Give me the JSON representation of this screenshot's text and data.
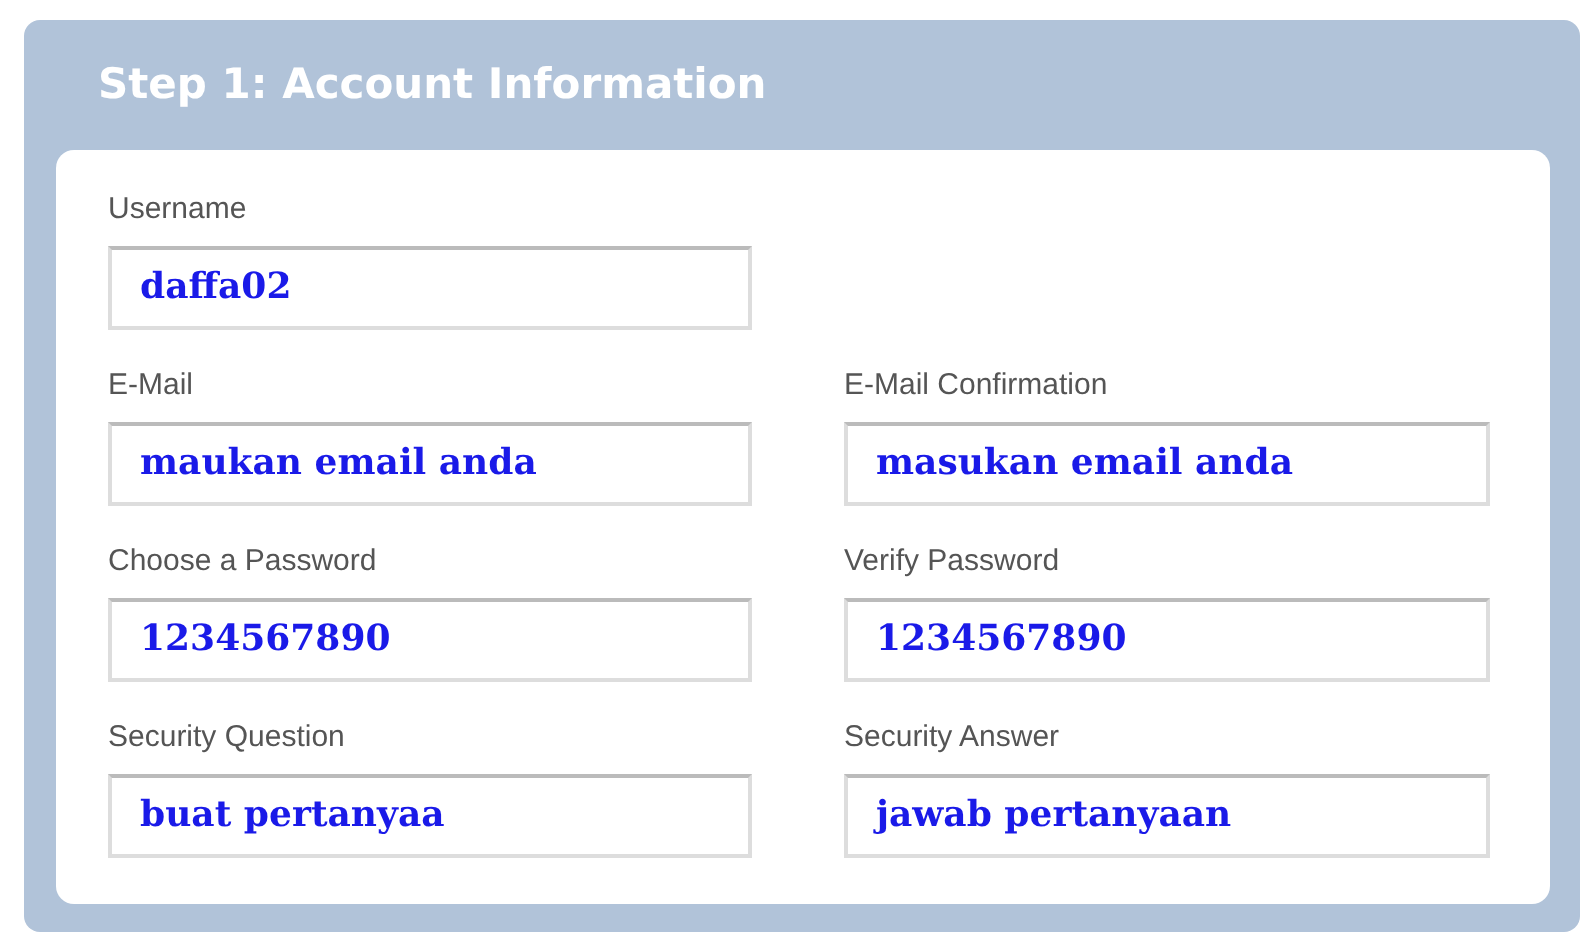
{
  "panel": {
    "title": "Step 1: Account Information"
  },
  "rows": [
    [
      {
        "label": "Username",
        "value": "daffa02"
      }
    ],
    [
      {
        "label": "E-Mail",
        "value": "maukan email anda"
      },
      {
        "label": "E-Mail Confirmation",
        "value": "masukan email anda"
      }
    ],
    [
      {
        "label": "Choose a Password",
        "value": "1234567890"
      },
      {
        "label": "Verify Password",
        "value": "1234567890"
      }
    ],
    [
      {
        "label": "Security Question",
        "value": "buat pertanyaa"
      },
      {
        "label": "Security Answer",
        "value": "jawab pertanyaan"
      }
    ]
  ]
}
